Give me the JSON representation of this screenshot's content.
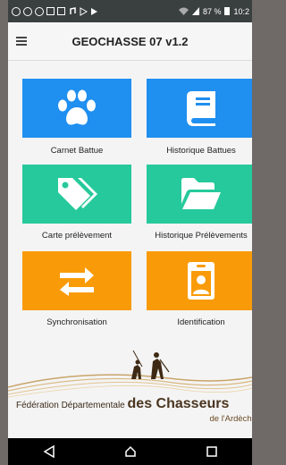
{
  "status_bar": {
    "battery_text": "87 %",
    "time": "10:2"
  },
  "app_bar": {
    "title": "GEOCHASSE 07 v1.2",
    "menu_icon": "hamburger-menu-icon"
  },
  "tiles": [
    {
      "label": "Carnet Battue",
      "icon": "paw-icon",
      "color": "#1f8ff0"
    },
    {
      "label": "Historique Battues",
      "icon": "book-icon",
      "color": "#1f8ff0"
    },
    {
      "label": "Carte prélèvement",
      "icon": "tags-icon",
      "color": "#26c99b"
    },
    {
      "label": "Historique Prélèvements",
      "icon": "folder-open-icon",
      "color": "#26c99b"
    },
    {
      "label": "Synchronisation",
      "icon": "exchange-arrows-icon",
      "color": "#f99b08"
    },
    {
      "label": "Identification",
      "icon": "id-badge-icon",
      "color": "#f99b08"
    }
  ],
  "footer": {
    "federation_prefix": "Fédération Départementale",
    "federation_name": "des Chasseurs",
    "region": "de l'Ardèche"
  },
  "nav_bar": {
    "back_icon": "back-triangle-icon",
    "home_icon": "home-icon",
    "recents_icon": "recents-square-icon"
  }
}
